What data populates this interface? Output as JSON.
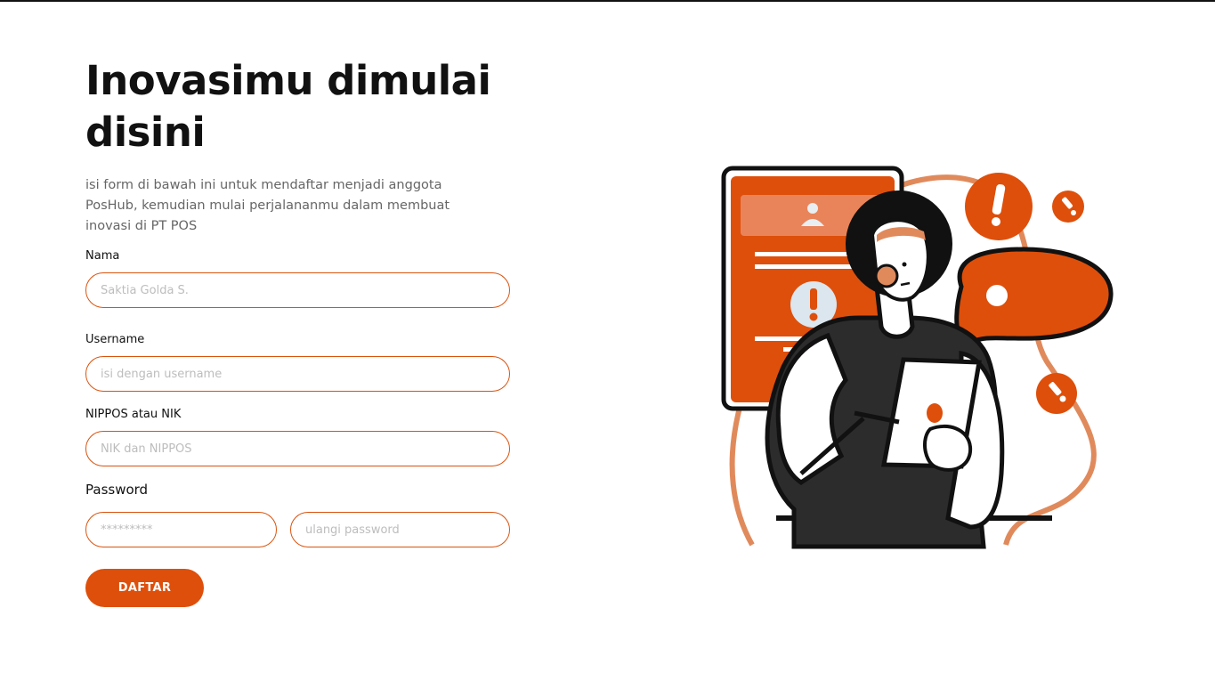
{
  "heading": "Inovasimu dimulai disini",
  "description": "isi form di bawah ini untuk mendaftar menjadi anggota PosHub, kemudian mulai perjalananmu dalam membuat inovasi di PT POS",
  "form": {
    "nama": {
      "label": "Nama",
      "placeholder": "Saktia Golda S.",
      "value": ""
    },
    "username": {
      "label": "Username",
      "placeholder": "isi dengan username",
      "value": ""
    },
    "nippos": {
      "label": "NIPPOS atau NIK",
      "placeholder": "NIK dan NIPPOS",
      "value": ""
    },
    "password": {
      "label": "Password",
      "placeholder": "*********",
      "value": ""
    },
    "password_confirm": {
      "placeholder": "ulangi password",
      "value": ""
    },
    "submit_label": "DAFTAR"
  },
  "illustration": {
    "icon": "person-with-tablet-alert-illustration",
    "accent_color": "#de4f0b"
  }
}
